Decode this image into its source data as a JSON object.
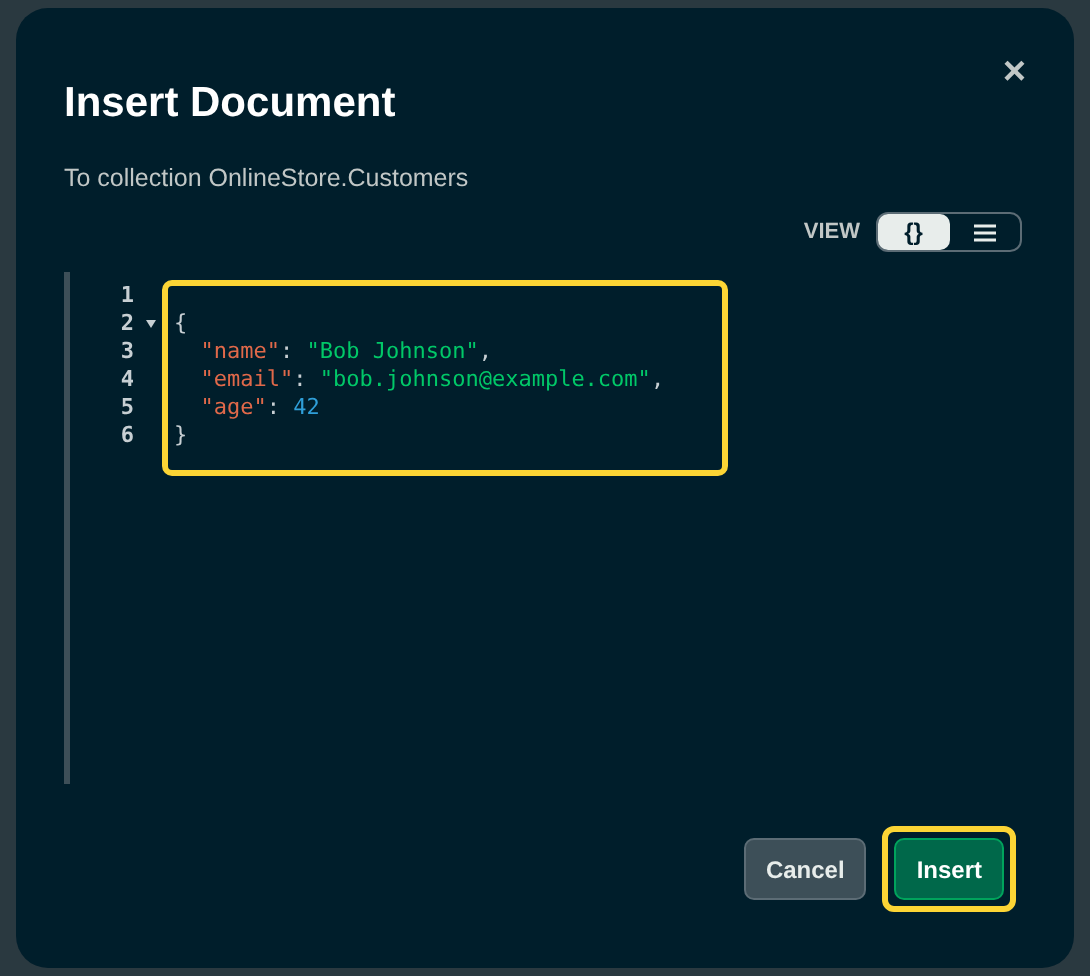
{
  "dialog": {
    "title": "Insert Document",
    "subtitle": "To collection OnlineStore.Customers",
    "close": "×"
  },
  "view_toggle": {
    "label": "VIEW",
    "options": [
      {
        "kind": "json",
        "label": "{}",
        "selected": true
      },
      {
        "kind": "list",
        "selected": false
      }
    ]
  },
  "editor": {
    "highlighted": true,
    "lines": [
      {
        "number": "1",
        "fold": false
      },
      {
        "number": "2",
        "fold": true,
        "tokens": [
          {
            "kind": "punct",
            "text": "{"
          }
        ]
      },
      {
        "number": "3",
        "fold": false,
        "tokens": [
          {
            "kind": "key",
            "text": "\"name\""
          },
          {
            "kind": "punct",
            "text": ": "
          },
          {
            "kind": "string",
            "text": "\"Bob Johnson\""
          },
          {
            "kind": "punct",
            "text": ","
          }
        ]
      },
      {
        "number": "4",
        "fold": false,
        "tokens": [
          {
            "kind": "key",
            "text": "\"email\""
          },
          {
            "kind": "punct",
            "text": ": "
          },
          {
            "kind": "string",
            "text": "\"bob.johnson@example.com\""
          },
          {
            "kind": "punct",
            "text": ","
          }
        ]
      },
      {
        "number": "5",
        "fold": false,
        "tokens": [
          {
            "kind": "key",
            "text": "\"age\""
          },
          {
            "kind": "punct",
            "text": ": "
          },
          {
            "kind": "number",
            "text": "42"
          }
        ]
      },
      {
        "number": "6",
        "fold": false,
        "tokens": [
          {
            "kind": "punct",
            "text": "}"
          }
        ]
      }
    ]
  },
  "buttons": [
    {
      "kind": "secondary",
      "label": "Cancel",
      "highlighted": false
    },
    {
      "kind": "primary",
      "label": "Insert",
      "highlighted": true
    }
  ]
}
